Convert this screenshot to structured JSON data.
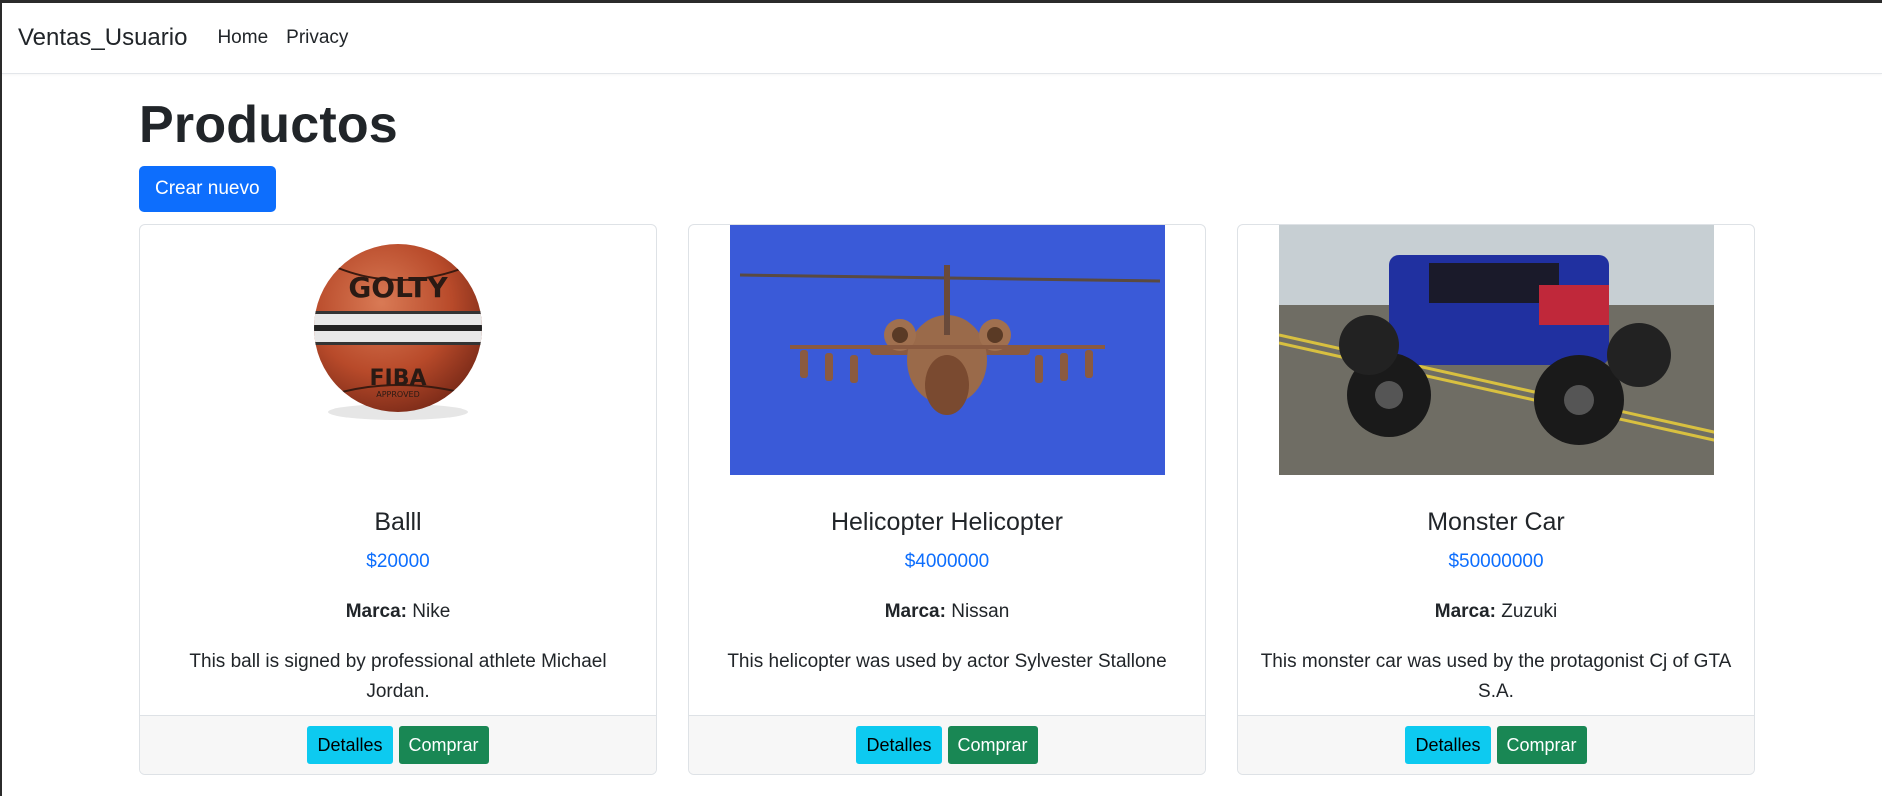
{
  "navbar": {
    "brand": "Ventas_Usuario",
    "links": [
      "Home",
      "Privacy"
    ]
  },
  "page": {
    "title": "Productos",
    "create_button": "Crear nuevo"
  },
  "products": [
    {
      "name": "Balll",
      "price": "$20000",
      "brand_label": "Marca:",
      "brand": "Nike",
      "description": "This ball is signed by professional athlete Michael Jordan.",
      "image": "basketball-image",
      "details_button": "Detalles",
      "buy_button": "Comprar"
    },
    {
      "name": "Helicopter Helicopter",
      "price": "$4000000",
      "brand_label": "Marca:",
      "brand": "Nissan",
      "description": "This helicopter was used by actor Sylvester Stallone",
      "image": "helicopter-image",
      "details_button": "Detalles",
      "buy_button": "Comprar"
    },
    {
      "name": "Monster Car",
      "price": "$50000000",
      "brand_label": "Marca:",
      "brand": "Zuzuki",
      "description": "This monster car was used by the protagonist Cj of GTA S.A.",
      "image": "monster-truck-image",
      "details_button": "Detalles",
      "buy_button": "Comprar"
    }
  ],
  "ball_print": {
    "maker": "GOLTY",
    "approval": "FIBA",
    "approval_sub": "APPROVED"
  },
  "colors": {
    "primary": "#0d6efd",
    "info": "#0dcaf0",
    "success": "#198754",
    "text": "#212529"
  }
}
